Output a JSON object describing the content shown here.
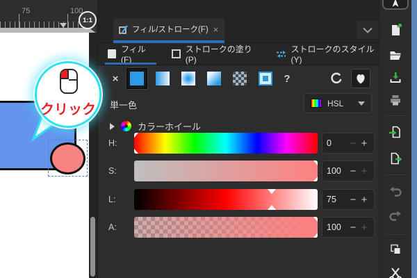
{
  "canvas": {
    "ruler": {
      "labels": [
        "75",
        "100"
      ]
    },
    "object_colors": {
      "rectangle_blue": "#6495ed",
      "ellipse_pink": "#ff8080"
    }
  },
  "annotations": {
    "click_label": "クリック",
    "zoom_badge": "1:1",
    "bubble_cyan": "#2ee2f2",
    "click_red": "#e8242a"
  },
  "panel": {
    "tab": {
      "label": "フィル/ストローク(F)",
      "close": "×"
    },
    "subtabs": [
      {
        "label": "フィル(F)",
        "active": true
      },
      {
        "label": "ストロークの塗り(P)",
        "active": false
      },
      {
        "label": "ストロークのスタイル(Y)",
        "active": false
      }
    ],
    "fill_types": {
      "none_label": "×",
      "unknown_label": "?"
    },
    "mode_label": "単一色",
    "color_space": "HSL",
    "wheel_label": "カラーホイール",
    "spin": {
      "minus": "−",
      "plus": "+"
    },
    "sliders": [
      {
        "label": "H:",
        "value": "0",
        "pos": 0,
        "minus_enabled": false,
        "plus_enabled": true
      },
      {
        "label": "S:",
        "value": "100",
        "pos": 100,
        "minus_enabled": true,
        "plus_enabled": false
      },
      {
        "label": "L:",
        "value": "75",
        "pos": 75,
        "minus_enabled": true,
        "plus_enabled": true
      },
      {
        "label": "A:",
        "value": "100",
        "pos": 100,
        "minus_enabled": true,
        "plus_enabled": false
      }
    ],
    "accent_blue": "#2a6db8",
    "fill_icon_blue": "#2b9be6"
  },
  "toolbar": {
    "icons": [
      "pointer",
      "new-document",
      "open-folder",
      "save",
      "print",
      "import",
      "export",
      "undo",
      "redo",
      "duplicate",
      "cut"
    ],
    "green_accent": "#35b33a"
  }
}
